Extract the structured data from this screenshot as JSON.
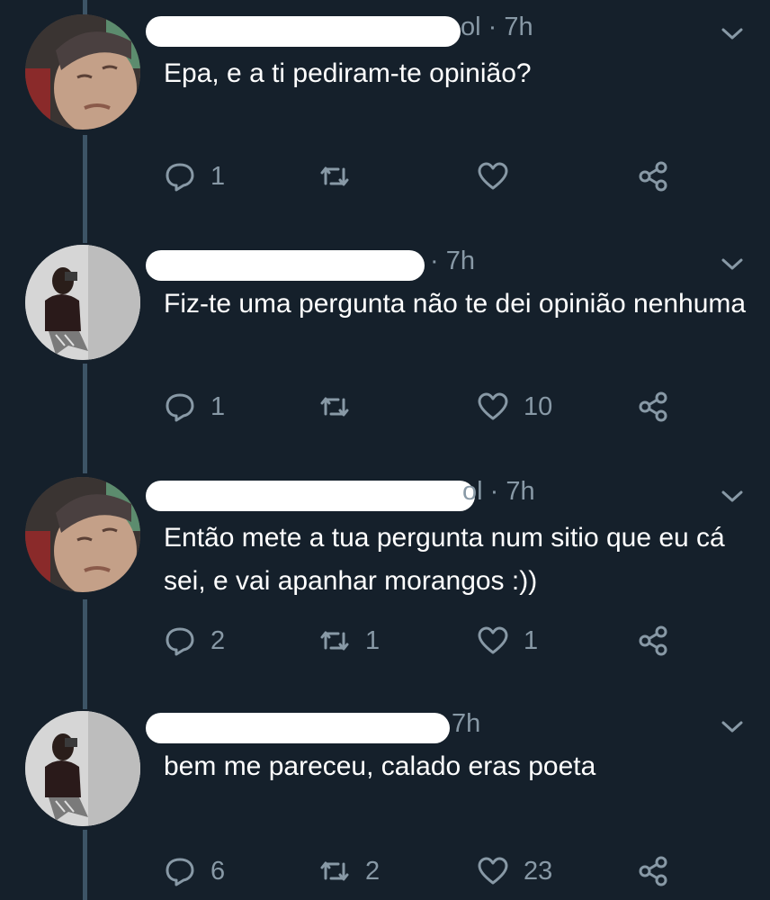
{
  "tweets": [
    {
      "avatar": "profile-photo",
      "time_visible": "ol · 7h",
      "text": "Epa, e a ti pediram-te opinião?",
      "replies": "1",
      "retweets": "",
      "likes": ""
    },
    {
      "avatar": "profile-photo",
      "time_visible": "· 7h",
      "text": "Fiz-te uma pergunta não te dei opinião nenhuma",
      "replies": "1",
      "retweets": "",
      "likes": "10"
    },
    {
      "avatar": "profile-photo",
      "time_visible": "ol · 7h",
      "text": "Então mete a tua pergunta num sitio que eu cá sei, e vai apanhar morangos :))",
      "replies": "2",
      "retweets": "1",
      "likes": "1"
    },
    {
      "avatar": "profile-photo",
      "time_visible": "7h",
      "text": "bem me pareceu, calado eras poeta",
      "replies": "6",
      "retweets": "2",
      "likes": "23"
    }
  ],
  "icons": {
    "reply": "reply-icon",
    "retweet": "retweet-icon",
    "like": "heart-icon",
    "share": "share-icon",
    "menu": "chevron-down-icon"
  },
  "colors": {
    "background": "#15202b",
    "text": "#ffffff",
    "muted": "#8899a6",
    "thread_line": "#3d5466",
    "redaction": "#ffffff"
  }
}
